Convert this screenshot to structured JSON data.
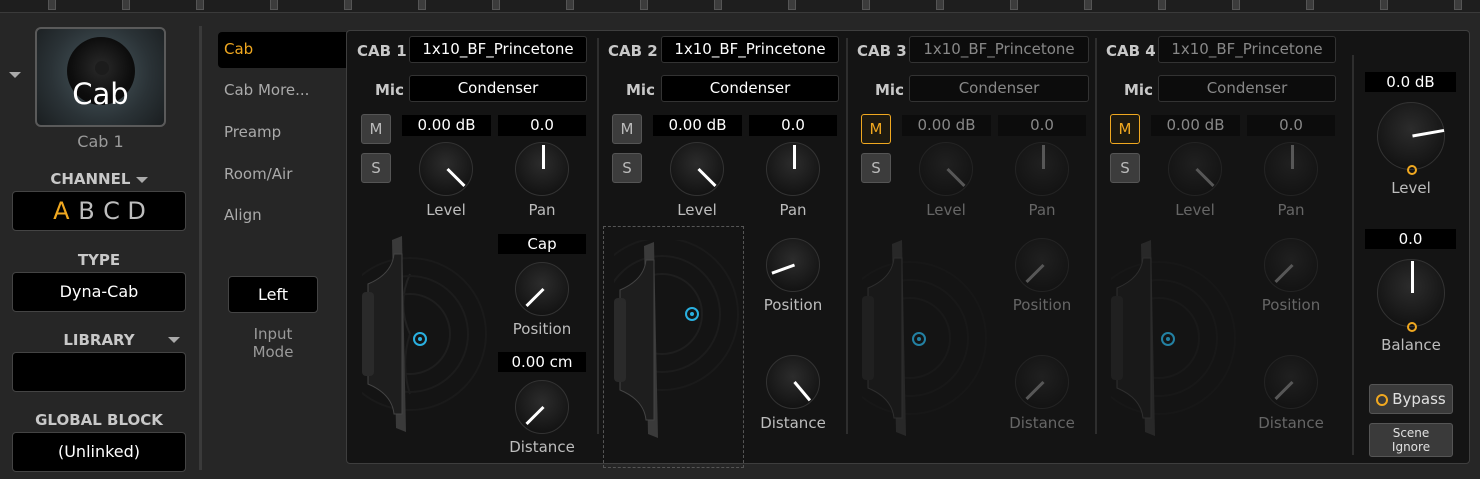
{
  "block": {
    "title": "Cab",
    "name": "Cab 1"
  },
  "channel": {
    "label": "CHANNEL",
    "letters": [
      "A",
      "B",
      "C",
      "D"
    ],
    "active": "A"
  },
  "type": {
    "label": "TYPE",
    "value": "Dyna-Cab"
  },
  "library": {
    "label": "LIBRARY",
    "value": ""
  },
  "global_block": {
    "label": "GLOBAL BLOCK",
    "value": "(Unlinked)"
  },
  "tabs": [
    {
      "label": "Cab",
      "active": true
    },
    {
      "label": "Cab More..."
    },
    {
      "label": "Preamp"
    },
    {
      "label": "Room/Air"
    },
    {
      "label": "Align"
    }
  ],
  "input_mode": {
    "value": "Left",
    "label_line1": "Input",
    "label_line2": "Mode"
  },
  "cabs": [
    {
      "label": "CAB 1",
      "ir": "1x10_BF_Princetone",
      "mic_label": "Mic",
      "mic": "Condenser",
      "mute": "M",
      "solo": "S",
      "muted": false,
      "level": "0.00 dB",
      "pan": "0.0",
      "level_label": "Level",
      "pan_label": "Pan",
      "cap": "Cap",
      "distance_value": "0.00 cm",
      "position_label": "Position",
      "distance_label": "Distance"
    },
    {
      "label": "CAB 2",
      "ir": "1x10_BF_Princetone",
      "mic_label": "Mic",
      "mic": "Condenser",
      "mute": "M",
      "solo": "S",
      "muted": false,
      "level": "0.00 dB",
      "pan": "0.0",
      "level_label": "Level",
      "pan_label": "Pan",
      "position_label": "Position",
      "distance_label": "Distance"
    },
    {
      "label": "CAB 3",
      "ir": "1x10_BF_Princetone",
      "mic_label": "Mic",
      "mic": "Condenser",
      "mute": "M",
      "solo": "S",
      "muted": true,
      "level": "0.00 dB",
      "pan": "0.0",
      "level_label": "Level",
      "pan_label": "Pan",
      "position_label": "Position",
      "distance_label": "Distance"
    },
    {
      "label": "CAB 4",
      "ir": "1x10_BF_Princetone",
      "mic_label": "Mic",
      "mic": "Condenser",
      "mute": "M",
      "solo": "S",
      "muted": true,
      "level": "0.00 dB",
      "pan": "0.0",
      "level_label": "Level",
      "pan_label": "Pan",
      "position_label": "Position",
      "distance_label": "Distance"
    }
  ],
  "output": {
    "level": "0.0 dB",
    "level_label": "Level",
    "balance": "0.0",
    "balance_label": "Balance",
    "bypass": "Bypass",
    "scene_ignore_line1": "Scene",
    "scene_ignore_line2": "Ignore"
  },
  "colors": {
    "accent": "#f0a820",
    "mic_dot": "#2ab0e0"
  }
}
